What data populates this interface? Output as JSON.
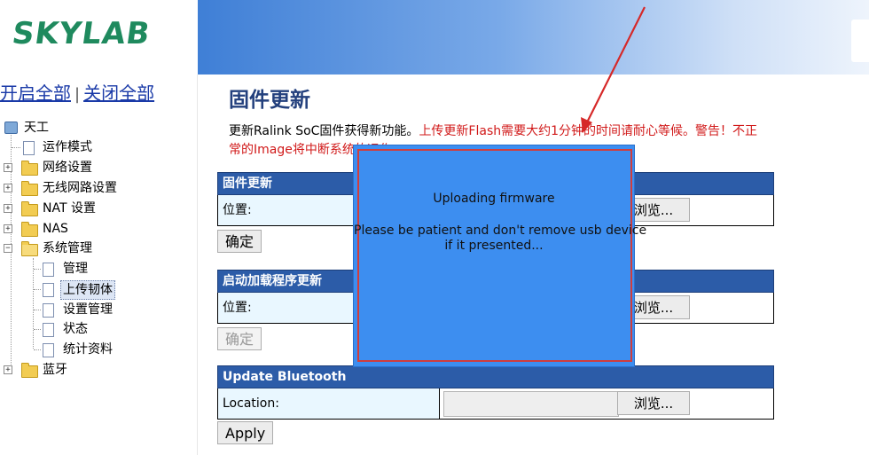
{
  "brand": {
    "logo_text": "SKYLAB"
  },
  "sidebar": {
    "expand_all": "开启全部",
    "separator": "|",
    "collapse_all": "关闭全部",
    "tree": {
      "root": "天工",
      "items": [
        {
          "label": "运作模式",
          "type": "doc"
        },
        {
          "label": "网络设置",
          "type": "folder"
        },
        {
          "label": "无线网路设置",
          "type": "folder"
        },
        {
          "label": "NAT 设置",
          "type": "folder"
        },
        {
          "label": "NAS",
          "type": "folder"
        },
        {
          "label": "系统管理",
          "type": "folder-open"
        },
        {
          "label": "管理",
          "type": "doc"
        },
        {
          "label": "上传韧体",
          "type": "doc",
          "selected": true
        },
        {
          "label": "设置管理",
          "type": "doc"
        },
        {
          "label": "状态",
          "type": "doc"
        },
        {
          "label": "统计资料",
          "type": "doc"
        },
        {
          "label": "蓝牙",
          "type": "folder"
        }
      ]
    }
  },
  "main": {
    "title": "固件更新",
    "description_black": "更新Ralink SoC固件获得新功能。",
    "description_red_1": "上传更新Flash需要大约1分钟的时间请耐心等候。警告！不正",
    "description_red_2": "常的Image将中断系统的运作",
    "sections": [
      {
        "header": "固件更新",
        "label": "位置:",
        "browse": "浏览...",
        "button": "确定",
        "button_disabled": false
      },
      {
        "header": "启动加载程序更新",
        "label": "位置:",
        "browse": "浏览...",
        "button": "确定",
        "button_disabled": true
      },
      {
        "header": "Update Bluetooth",
        "label": "Location:",
        "browse": "浏览...",
        "button": "Apply",
        "button_disabled": false
      }
    ]
  },
  "overlay": {
    "title": "Uploading firmware",
    "message_line1": "Please be patient and don't remove usb device",
    "message_line2": "if it presented..."
  },
  "colors": {
    "header_bar": "#2c5ca8",
    "overlay_bg": "#3d8ef0",
    "overlay_border": "#d03d3d",
    "warning_red": "#d11a1a",
    "title_blue": "#23407d",
    "logo_green": "#1f8a5e"
  }
}
